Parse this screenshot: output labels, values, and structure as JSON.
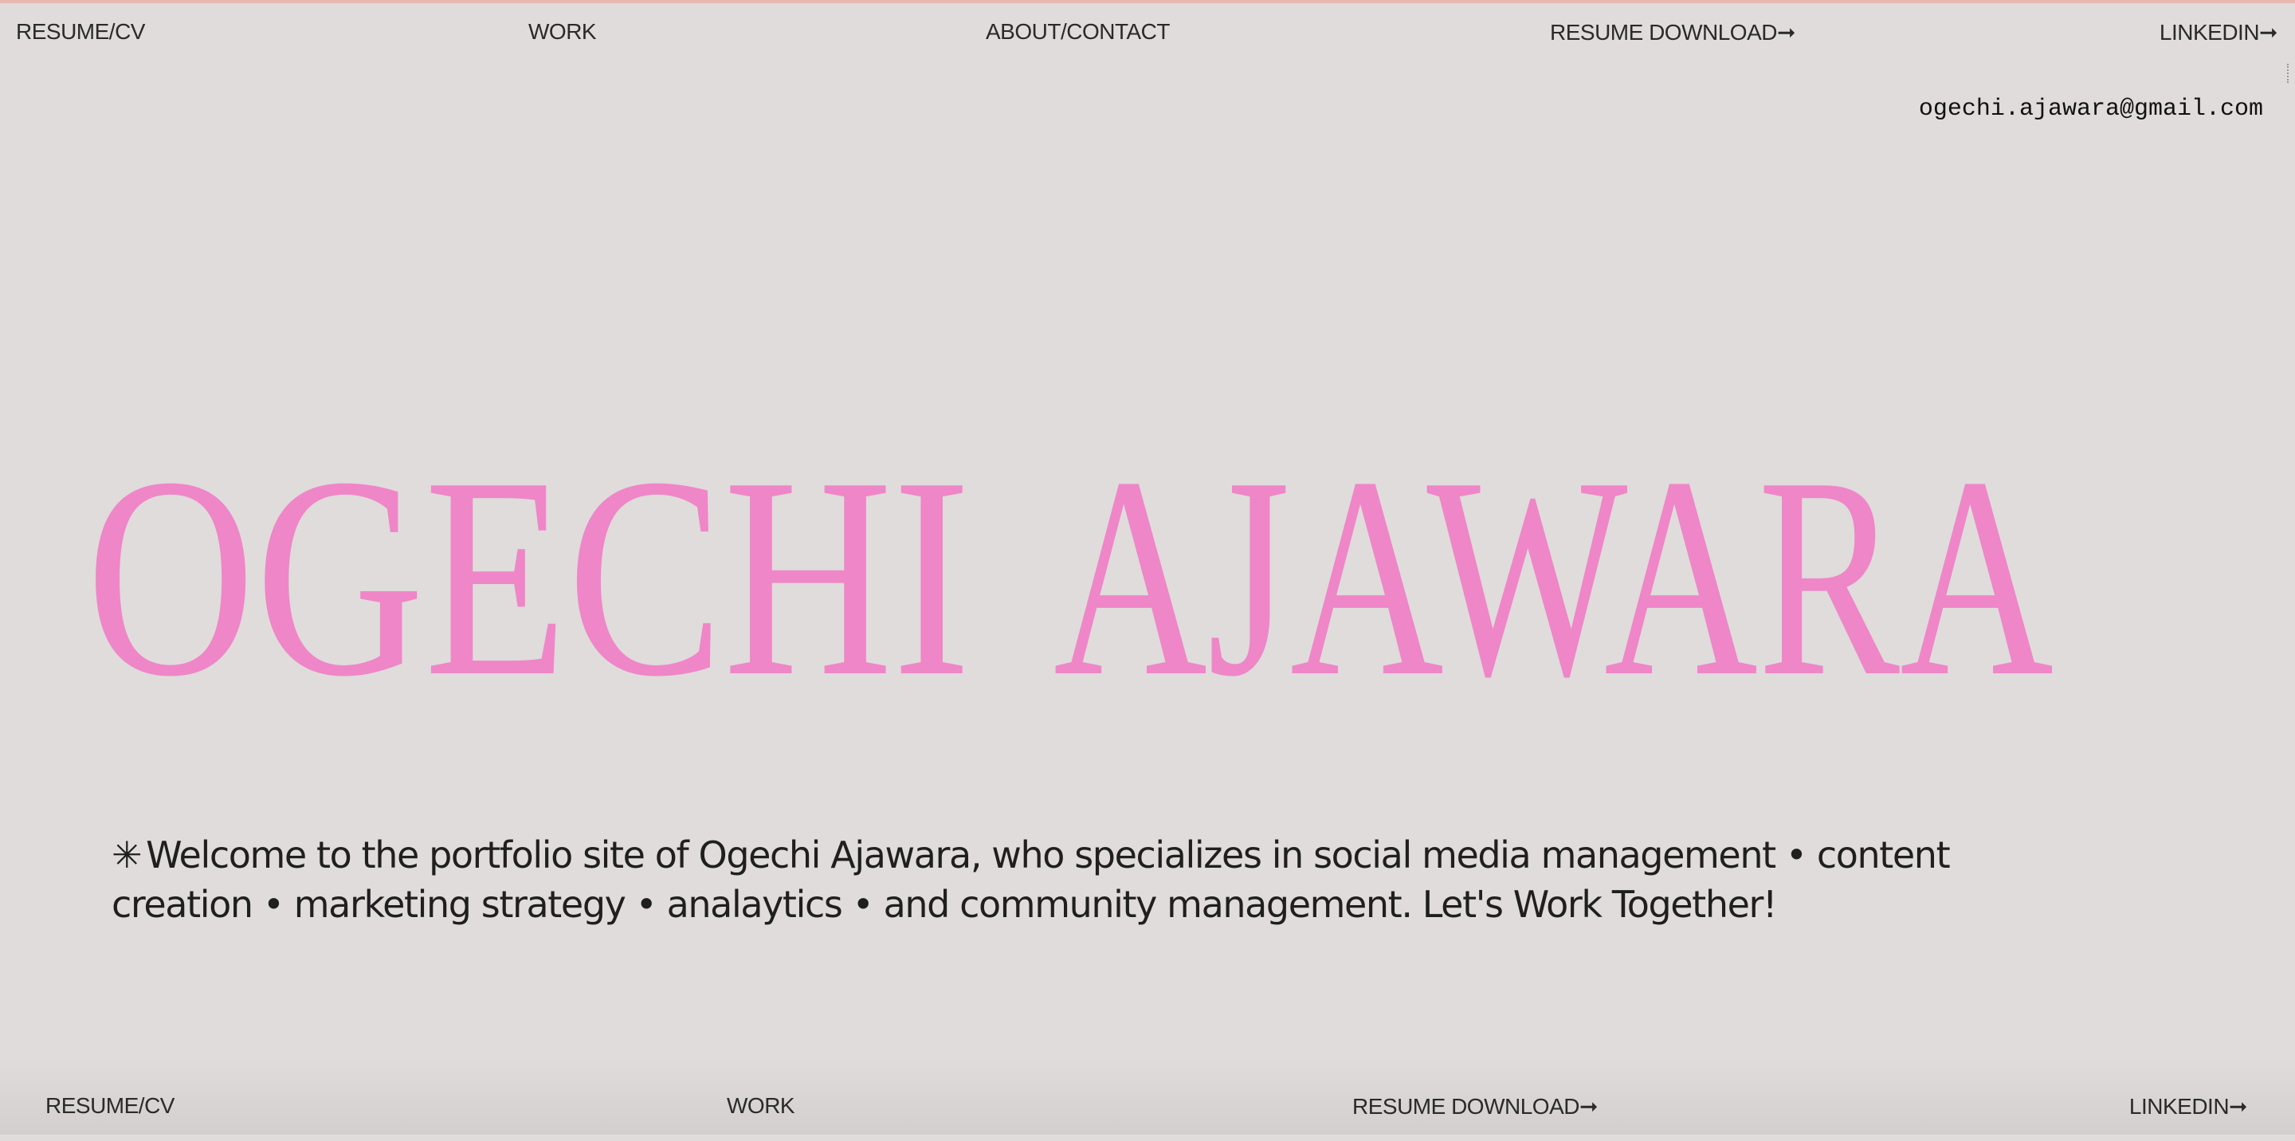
{
  "colors": {
    "background": "#dfdcdb",
    "accent_pink": "#ef86c8",
    "text": "#1e1e1e"
  },
  "nav_top": {
    "resume_cv": "RESUME/CV",
    "work": "WORK",
    "about_contact": "ABOUT/CONTACT",
    "resume_download": "RESUME DOWNLOAD➞",
    "linkedin": "LINKEDIN➞"
  },
  "contact": {
    "email": "ogechi.ajawara@gmail.com"
  },
  "hero": {
    "first_name": "OGECHI",
    "last_name": "AJAWARA"
  },
  "intro": {
    "star_icon": "✳",
    "text": "Welcome to the portfolio site of Ogechi Ajawara, who specializes in social media management • content creation • marketing strategy • analaytics • and community management. Let's Work Together!"
  },
  "nav_bottom": {
    "resume_cv": "RESUME/CV",
    "work": "WORK",
    "resume_download": "RESUME DOWNLOAD➞",
    "linkedin": "LINKEDIN➞"
  }
}
